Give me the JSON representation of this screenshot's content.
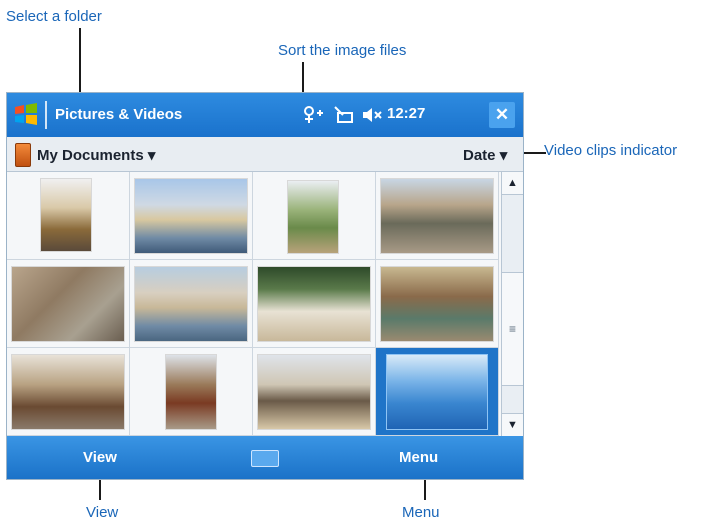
{
  "callouts": {
    "select_folder": "Select a folder",
    "sort_files": "Sort the image files",
    "video_indicator": "Video clips indicator",
    "view": "View",
    "menu": "Menu"
  },
  "titlebar": {
    "app_title": "Pictures & Videos",
    "time": "12:27",
    "close": "✕"
  },
  "toolbar": {
    "folder": "My Documents",
    "sort": "Date"
  },
  "grid": {
    "rows": 3,
    "columns": 4,
    "selected_index": 11
  },
  "menubar": {
    "left": "View",
    "right": "Menu"
  },
  "colors": {
    "accent": "#1a72cc",
    "callout": "#1a66b8"
  }
}
